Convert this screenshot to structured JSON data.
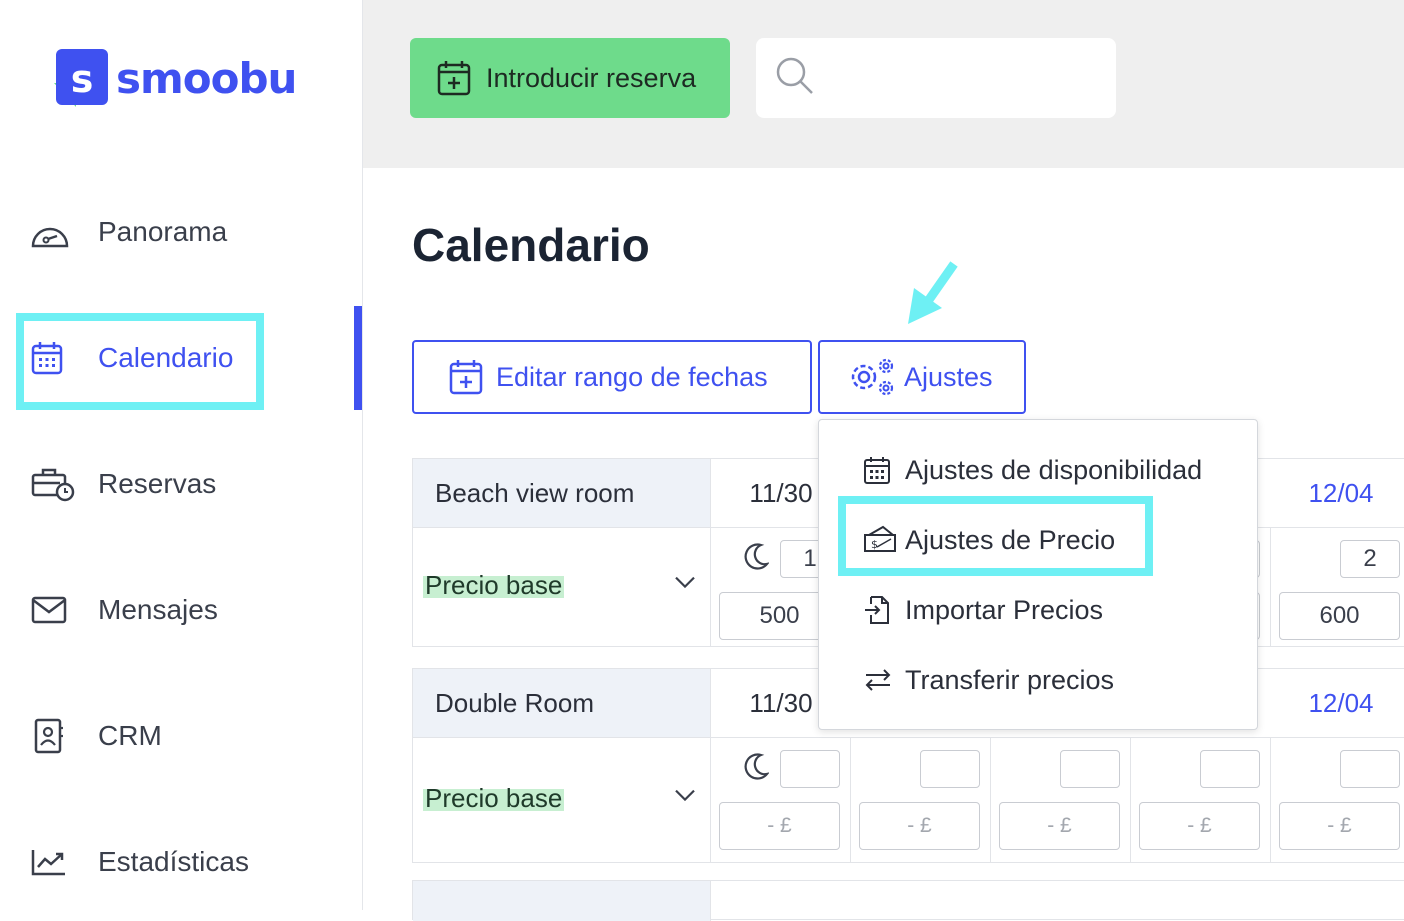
{
  "brand": {
    "name": "smoobu",
    "mark_letter": "s",
    "color": "#3f51f0"
  },
  "sidebar": {
    "items": [
      {
        "label": "Panorama",
        "icon": "dashboard-gauge-icon"
      },
      {
        "label": "Calendario",
        "icon": "calendar-icon",
        "active": true
      },
      {
        "label": "Reservas",
        "icon": "suitcase-clock-icon"
      },
      {
        "label": "Mensajes",
        "icon": "envelope-icon"
      },
      {
        "label": "CRM",
        "icon": "contact-book-icon"
      },
      {
        "label": "Estadísticas",
        "icon": "trend-chart-icon"
      }
    ]
  },
  "topbar": {
    "new_booking_label": "Introducir reserva",
    "search_placeholder": ""
  },
  "main": {
    "title": "Calendario",
    "toolbar": {
      "edit_range_label": "Editar rango de fechas",
      "settings_label": "Ajustes"
    },
    "settings_menu": [
      {
        "label": "Ajustes de disponibilidad",
        "icon": "calendar-grid-icon"
      },
      {
        "label": "Ajustes de Precio",
        "icon": "price-tag-icon",
        "highlighted": true
      },
      {
        "label": "Importar Precios",
        "icon": "file-import-icon"
      },
      {
        "label": "Transferir precios",
        "icon": "transfer-arrows-icon"
      }
    ],
    "rooms": [
      {
        "name": "Beach view room",
        "dates": [
          "11/30",
          "",
          "",
          "",
          "12/04"
        ],
        "price_label": "Precio base",
        "min_stay": [
          "1",
          "",
          "",
          "",
          "2"
        ],
        "prices": [
          "500",
          "",
          "",
          "",
          "600"
        ]
      },
      {
        "name": "Double Room",
        "dates": [
          "11/30",
          "",
          "",
          "",
          "12/04"
        ],
        "price_label": "Precio base",
        "min_stay": [
          "",
          "",
          "",
          "",
          ""
        ],
        "prices": [
          "- £",
          "- £",
          "- £",
          "- £",
          "- £"
        ]
      }
    ]
  },
  "colors": {
    "accent": "#3f51f0",
    "green_button": "#6edb8b",
    "highlight": "#6ef0f4",
    "price_tag_bg": "#c7efd1"
  }
}
